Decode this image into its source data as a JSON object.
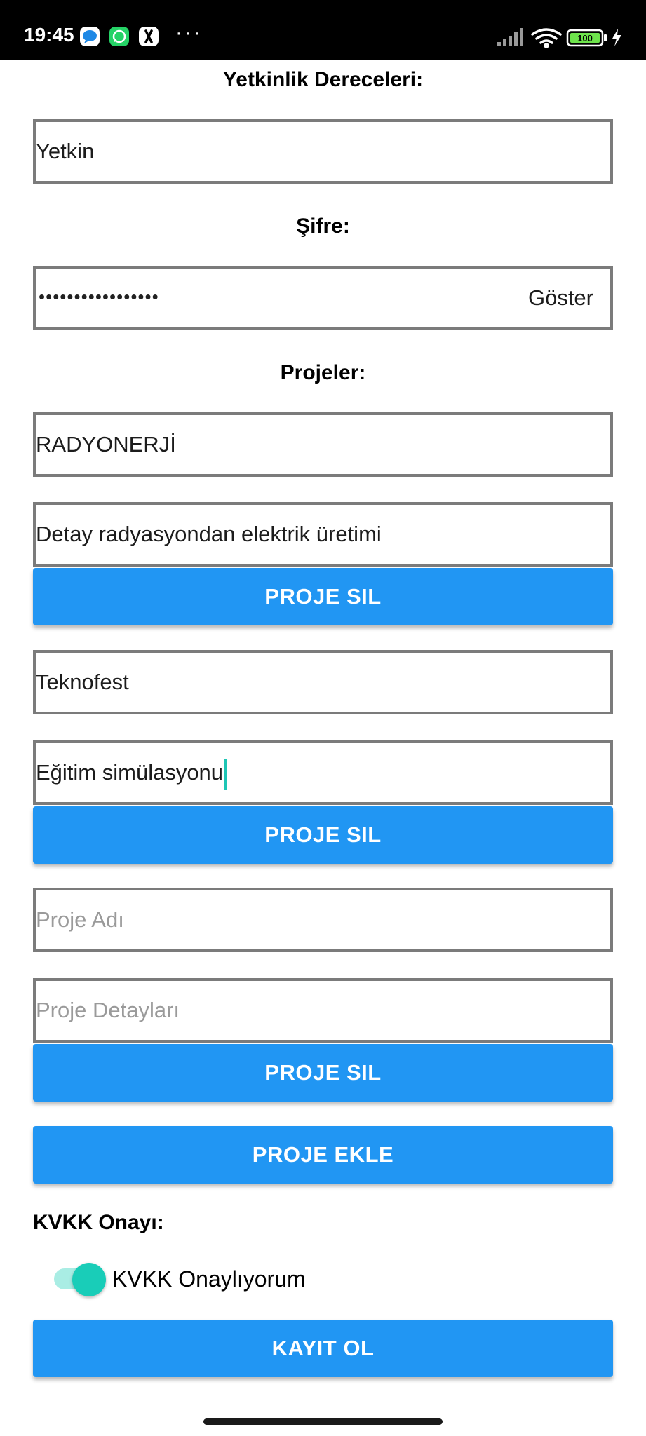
{
  "status_bar": {
    "time": "19:45",
    "battery": "100",
    "icons": [
      "messages-icon",
      "whatsapp-icon",
      "app-icon",
      "more-icon",
      "signal-icon",
      "wifi-icon",
      "battery-icon",
      "charging-icon"
    ]
  },
  "form": {
    "competency_label": "Yetkinlik Dereceleri:",
    "competency_value": "Yetkin",
    "password_label": "Şifre:",
    "password_mask": "•••••••••••••••••",
    "show_label": "Göster",
    "projects_label": "Projeler:",
    "projects": [
      {
        "name": "RADYONERJİ",
        "detail": "Detay radyasyondan elektrik üretimi",
        "delete_label": "PROJE SIL"
      },
      {
        "name": "Teknofest",
        "detail": "Eğitim simülasyonu",
        "delete_label": "PROJE SIL"
      },
      {
        "name_placeholder": "Proje Adı",
        "detail_placeholder": "Proje Detayları",
        "delete_label": "PROJE SIL"
      }
    ],
    "add_project_label": "PROJE EKLE",
    "kvkk_label": "KVKK Onayı:",
    "kvkk_switch_label": "KVKK Onaylıyorum",
    "kvkk_checked": true,
    "register_label": "KAYIT OL"
  },
  "colors": {
    "primary": "#2196f3",
    "switch_accent": "#19cdb8",
    "border": "#7b7b7b"
  }
}
